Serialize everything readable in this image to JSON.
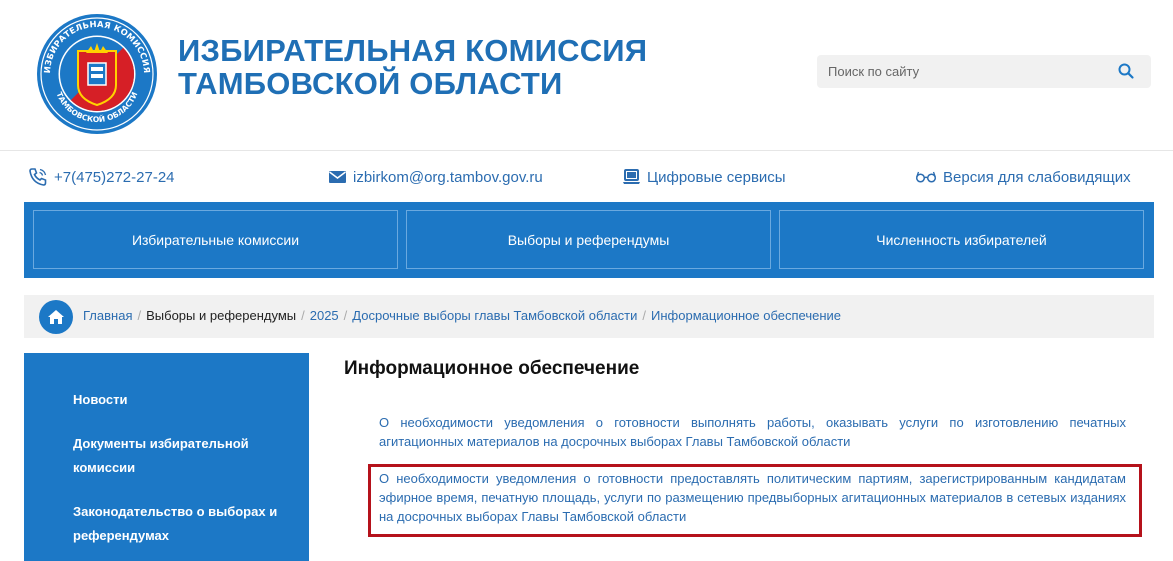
{
  "header": {
    "logo": {
      "ring_text_top": "ИЗБИРАТЕЛЬНАЯ КОМИССИЯ",
      "ring_text_bottom": "ТАМБОВСКОЙ ОБЛАСТИ"
    },
    "title_line1": "ИЗБИРАТЕЛЬНАЯ КОМИССИЯ",
    "title_line2": "ТАМБОВСКОЙ ОБЛАСТИ",
    "search": {
      "placeholder": "Поиск по сайту",
      "icon": "search-icon"
    }
  },
  "contacts": {
    "phone": {
      "icon": "phone-icon",
      "text": "+7(475)272-27-24"
    },
    "email": {
      "icon": "envelope-icon",
      "text": "izbirkom@org.tambov.gov.ru"
    },
    "digital": {
      "icon": "laptop-icon",
      "text": "Цифровые сервисы"
    },
    "lowvision": {
      "icon": "glasses-icon",
      "text": "Версия для слабовидящих"
    }
  },
  "topnav": {
    "items": [
      {
        "label": "Избирательные комиссии"
      },
      {
        "label": "Выборы и референдумы"
      },
      {
        "label": "Численность избирателей"
      }
    ]
  },
  "breadcrumb": {
    "home_icon": "home-icon",
    "items": [
      {
        "label": "Главная",
        "link": true
      },
      {
        "label": "Выборы и референдумы",
        "link": false
      },
      {
        "label": "2025",
        "link": true
      },
      {
        "label": "Досрочные выборы главы Тамбовской области",
        "link": true
      },
      {
        "label": "Информационное обеспечение",
        "link": true
      }
    ],
    "separator": "/"
  },
  "sidebar": {
    "items": [
      {
        "label": "Новости"
      },
      {
        "label": "Документы избирательной комиссии"
      },
      {
        "label": "Законодательство о выборах и референдумах"
      }
    ]
  },
  "main": {
    "title": "Информационное обеспечение",
    "documents": [
      {
        "text": "О необходимости уведомления о готовности выполнять работы, оказывать услуги по изготовлению печатных агитационных материалов на досрочных выборах Главы Тамбовской области"
      },
      {
        "text": "О необходимости уведомления о готовности предоставлять политическим партиям, зарегистрированным кандидатам эфирное время, печатную площадь, услуги по размещению предвыборных агитационных материалов в сетевых изданиях на досрочных выборах Главы Тамбовской области",
        "highlighted": true
      }
    ]
  },
  "colors": {
    "brand_blue": "#1c78c6",
    "link_blue": "#2b6cb0",
    "title_blue": "#1f6fb5",
    "highlight_red": "#b5121b"
  }
}
